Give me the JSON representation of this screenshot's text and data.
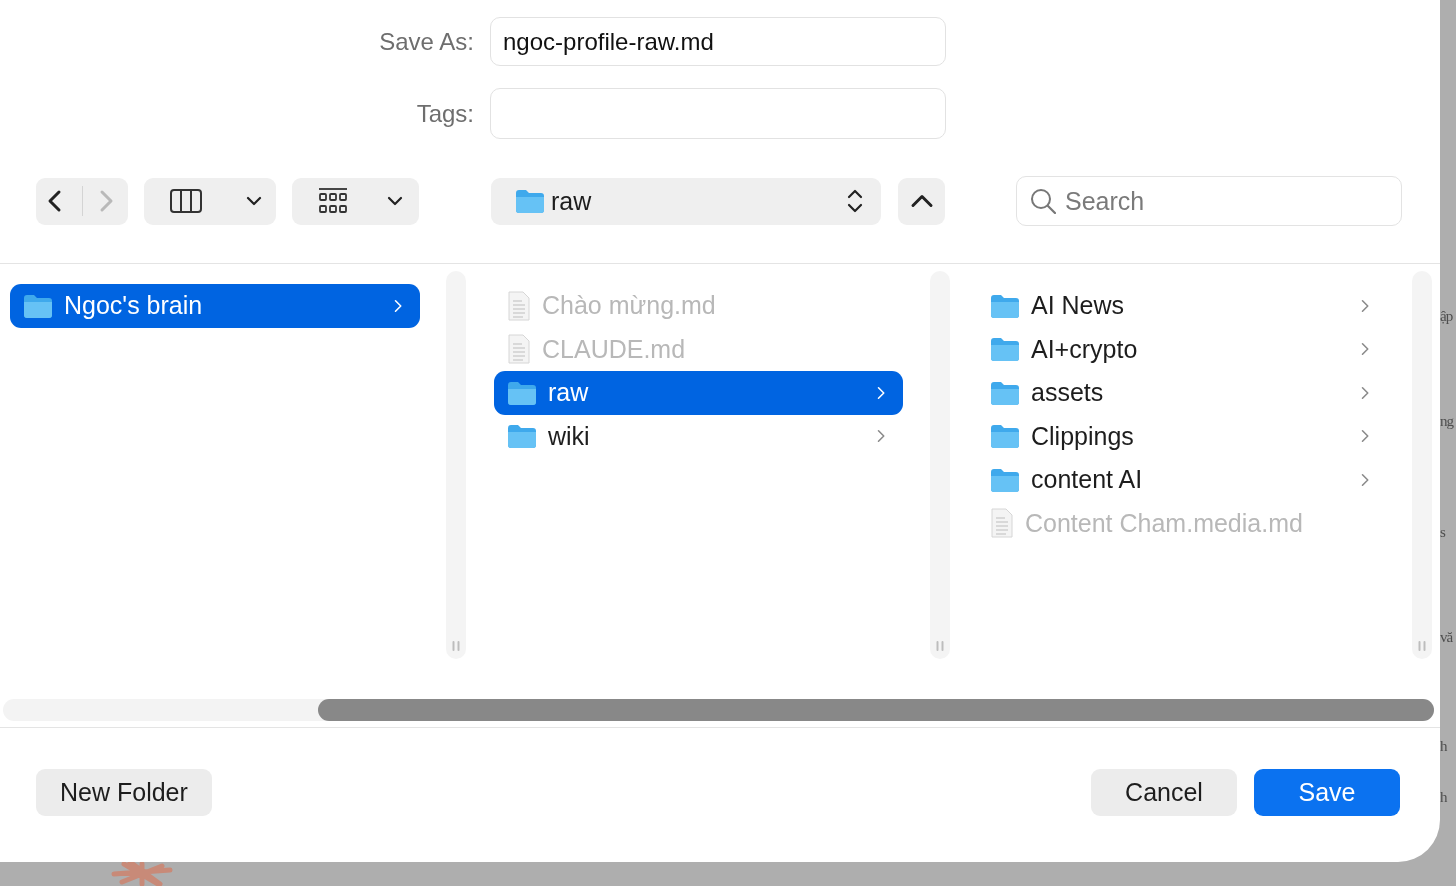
{
  "save_as": {
    "label": "Save As:",
    "value": "ngoc-profile-raw.md"
  },
  "tags": {
    "label": "Tags:"
  },
  "toolbar": {
    "nav": [
      {
        "kind": "back",
        "disabled": false
      },
      {
        "kind": "forward",
        "disabled": true
      }
    ],
    "location": "raw",
    "search": {
      "placeholder": "Search"
    }
  },
  "columns": [
    {
      "items": [
        {
          "name": "Ngoc's brain",
          "kind": "folder",
          "selected": true,
          "disabled": false
        }
      ]
    },
    {
      "items": [
        {
          "name": "Chào mừng.md",
          "kind": "file",
          "selected": false,
          "disabled": true
        },
        {
          "name": "CLAUDE.md",
          "kind": "file",
          "selected": false,
          "disabled": true
        },
        {
          "name": "raw",
          "kind": "folder",
          "selected": true,
          "disabled": false
        },
        {
          "name": "wiki",
          "kind": "folder",
          "selected": false,
          "disabled": false
        }
      ]
    },
    {
      "items": [
        {
          "name": "AI News",
          "kind": "folder",
          "selected": false,
          "disabled": false
        },
        {
          "name": "AI+crypto",
          "kind": "folder",
          "selected": false,
          "disabled": false
        },
        {
          "name": "assets",
          "kind": "folder",
          "selected": false,
          "disabled": false
        },
        {
          "name": "Clippings",
          "kind": "folder",
          "selected": false,
          "disabled": false
        },
        {
          "name": "content AI",
          "kind": "folder",
          "selected": false,
          "disabled": false
        },
        {
          "name": "Content Cham.media.md",
          "kind": "file",
          "selected": false,
          "disabled": true
        }
      ]
    }
  ],
  "buttons": [
    {
      "label": "New Folder",
      "kind": "secondary"
    },
    {
      "label": "Cancel",
      "kind": "secondary"
    },
    {
      "label": "Save",
      "kind": "default"
    }
  ],
  "background_text": [
    "ập",
    "ng",
    "s",
    "vă",
    "h",
    "h"
  ]
}
